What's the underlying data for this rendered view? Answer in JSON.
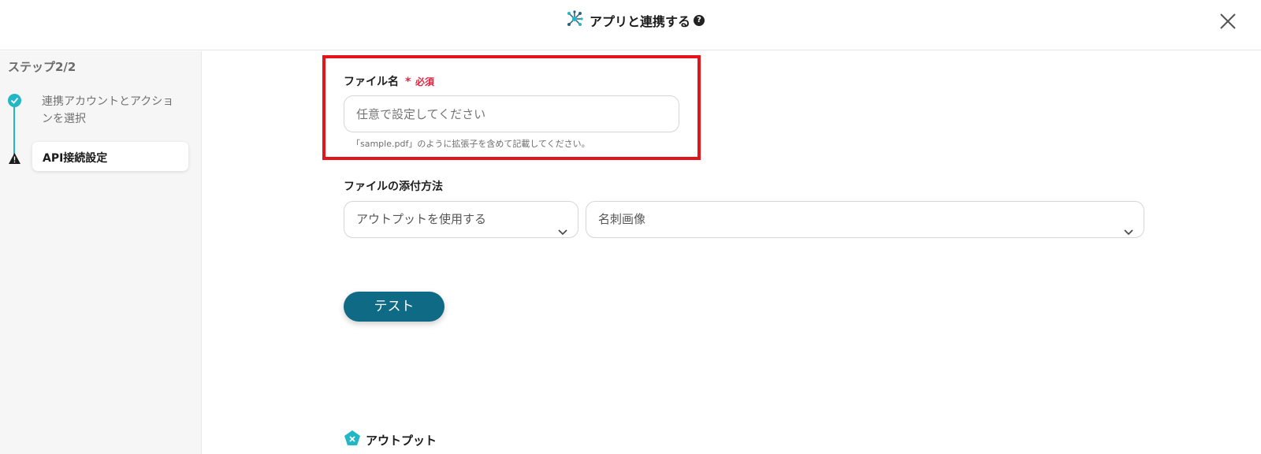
{
  "header": {
    "title": "アプリと連携する",
    "help_icon": "question-circle-icon",
    "close_icon": "close-icon",
    "app_icon": "network-nodes-icon"
  },
  "sidebar": {
    "step_title": "ステップ2/2",
    "steps": [
      {
        "label": "連携アカウントとアクションを選択",
        "status": "done",
        "icon": "check-circle-icon"
      },
      {
        "label": "API接続設定",
        "status": "warning",
        "icon": "warning-triangle-icon"
      }
    ]
  },
  "form": {
    "file_name": {
      "label": "ファイル名",
      "required_mark": "*",
      "required_label": "必須",
      "placeholder": "任意で設定してください",
      "hint": "「sample.pdf」のように拡張子を含めて記載してください。"
    },
    "attachment": {
      "label": "ファイルの添付方法",
      "method_value": "アウトプットを使用する",
      "source_value": "名刺画像"
    },
    "test_button": "テスト",
    "output_label": "アウトプット"
  },
  "colors": {
    "accent": "#21b7c4",
    "button": "#0f6a85",
    "required": "#e0243f",
    "highlight": "#e4141a"
  }
}
